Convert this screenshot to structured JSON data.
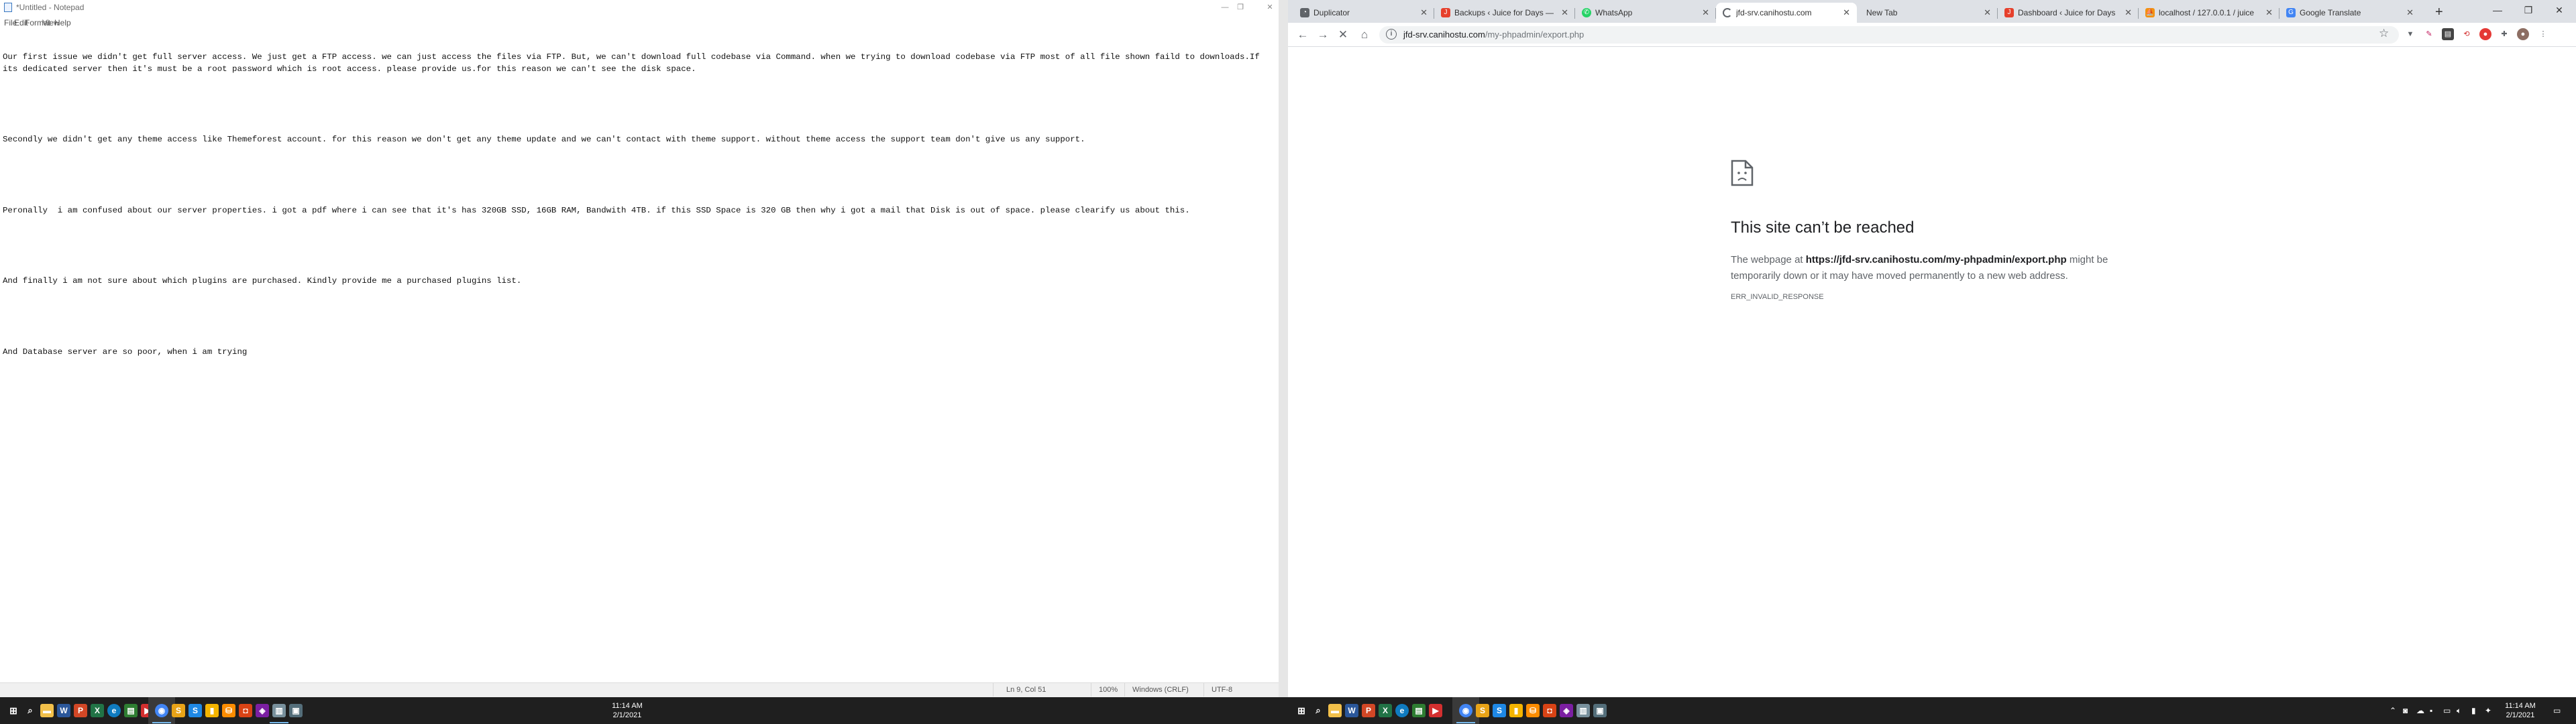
{
  "notepad": {
    "title": "*Untitled - Notepad",
    "menu": [
      "File",
      "Edit",
      "Format",
      "View",
      "Help"
    ],
    "lines": [
      "Our first issue we didn't get full server access. We just get a FTP access. we can just access the files via FTP. But, we can't download full codebase via Command. when we trying to download codebase via FTP most of all file shown faild to downloads.If its dedicated server then it's must be a root password which is root access. please provide us.for this reason we can't see the disk space.",
      "",
      "Secondly we didn't get any theme access like Themeforest account. for this reason we don't get any theme update and we can't contact with theme support. without theme access the support team don't give us any support.",
      "",
      "Peronally  i am confused about our server properties. i got a pdf where i can see that it's has 320GB SSD, 16GB RAM, Bandwith 4TB. if this SSD Space is 320 GB then why i got a mail that Disk is out of space. please clearify us about this.",
      "",
      "And finally i am not sure about which plugins are purchased. Kindly provide me a purchased plugins list.",
      "",
      "And Database server are so poor, when i am trying"
    ],
    "status": {
      "position": "Ln 9, Col 51",
      "zoom": "100%",
      "line_ending": "Windows (CRLF)",
      "encoding": "UTF-8"
    }
  },
  "chrome": {
    "tabs": [
      {
        "label": "Duplicator",
        "icon": "duplicator-icon",
        "color": "#5f6368",
        "active": false
      },
      {
        "label": "Backups ‹ Juice for Days —",
        "icon": "wordpress-site-icon",
        "color": "#e6402c",
        "active": false
      },
      {
        "label": "WhatsApp",
        "icon": "whatsapp-icon",
        "color": "#25d366",
        "active": false
      },
      {
        "label": "jfd-srv.canihostu.com",
        "icon": "loading-spinner-icon",
        "color": "#5f6368",
        "active": true
      },
      {
        "label": "New Tab",
        "icon": "",
        "color": "",
        "active": false
      },
      {
        "label": "Dashboard ‹ Juice for Days",
        "icon": "wordpress-site-icon",
        "color": "#e6402c",
        "active": false
      },
      {
        "label": "localhost / 127.0.0.1 / juice",
        "icon": "phpmyadmin-icon",
        "color": "#f29111",
        "active": false
      },
      {
        "label": "Google Translate",
        "icon": "google-translate-icon",
        "color": "#4285f4",
        "active": false
      }
    ],
    "url_host": "jfd-srv.canihostu.com",
    "url_path": "/my-phpadmin/export.php",
    "error": {
      "title": "This site can’t be reached",
      "body_prefix": "The webpage at ",
      "body_url": "https://jfd-srv.canihostu.com/my-phpadmin/export.php",
      "body_suffix": " might be temporarily down or it may have moved permanently to a new web address.",
      "code": "ERR_INVALID_RESPONSE"
    }
  },
  "taskbar_left": {
    "time": "11:14 AM",
    "date": "2/1/2021"
  },
  "taskbar_right": {
    "time": "11:14 AM",
    "date": "2/1/2021"
  },
  "colors": {
    "taskbar_bg": "#1f1f1f",
    "chrome_tabstrip": "#dee1e6",
    "error_title": "#202124",
    "error_text": "#5f6368"
  }
}
